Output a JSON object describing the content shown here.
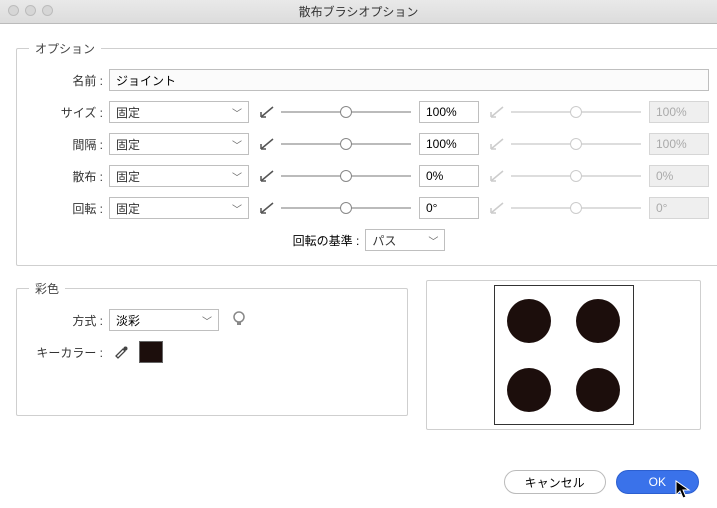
{
  "window": {
    "title": "散布ブラシオプション"
  },
  "options": {
    "legend": "オプション",
    "name_label": "名前 :",
    "name_value": "ジョイント",
    "rows": {
      "size": {
        "label": "サイズ :",
        "mode": "固定",
        "value1": "100%",
        "value2": "100%",
        "thumb1": 50,
        "thumb2": 50
      },
      "spacing": {
        "label": "間隔 :",
        "mode": "固定",
        "value1": "100%",
        "value2": "100%",
        "thumb1": 50,
        "thumb2": 50
      },
      "scatter": {
        "label": "散布 :",
        "mode": "固定",
        "value1": "0%",
        "value2": "0%",
        "thumb1": 50,
        "thumb2": 50
      },
      "rotation": {
        "label": "回転 :",
        "mode": "固定",
        "value1": "0°",
        "value2": "0°",
        "thumb1": 50,
        "thumb2": 50
      }
    },
    "rotation_basis_label": "回転の基準 :",
    "rotation_basis_value": "パス"
  },
  "colorize": {
    "legend": "彩色",
    "method_label": "方式 :",
    "method_value": "淡彩",
    "keycolor_label": "キーカラー :"
  },
  "buttons": {
    "cancel": "キャンセル",
    "ok": "OK"
  }
}
